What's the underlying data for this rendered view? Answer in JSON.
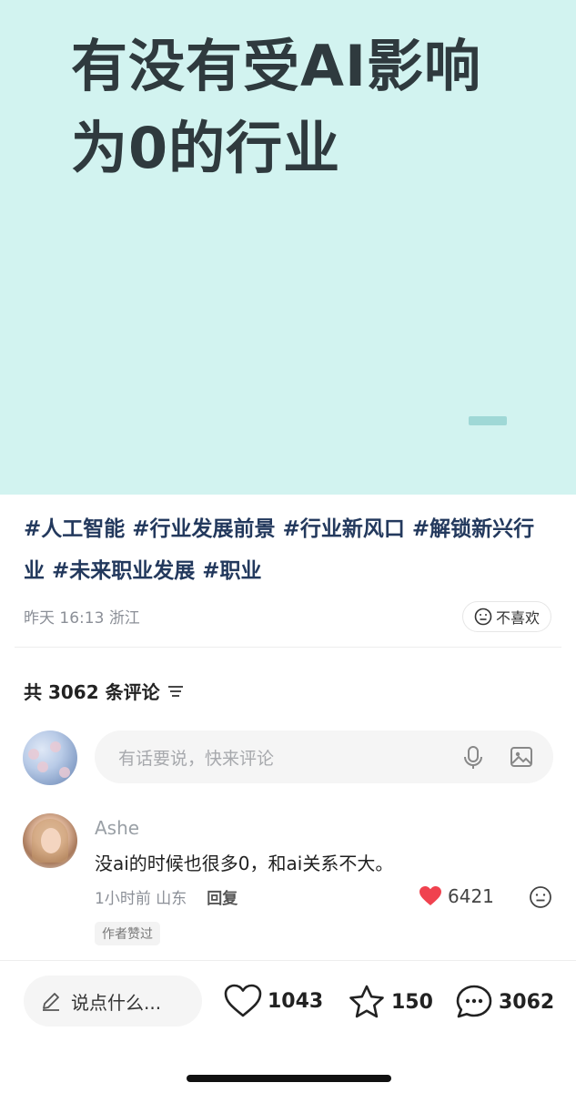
{
  "cover": {
    "title_line1": "有没有受AI影响",
    "title_line2": "为0的行业",
    "background": "#d2f3f0"
  },
  "tags": [
    "#人工智能",
    "#行业发展前景",
    "#行业新风口",
    "#解锁新兴行业",
    "#未来职业发展",
    "#职业"
  ],
  "meta": {
    "time": "昨天 16:13",
    "location": "浙江",
    "dislike_label": "不喜欢"
  },
  "comments": {
    "count_label": "共 3062 条评论",
    "input_placeholder": "有话要说，快来评论",
    "items": [
      {
        "author": "Ashe",
        "text": "没ai的时候也很多0，和ai关系不大。",
        "time": "1小时前",
        "location": "山东",
        "reply_label": "回复",
        "likes": "6421",
        "badge": "作者赞过"
      }
    ]
  },
  "bottom_bar": {
    "input_label": "说点什么...",
    "likes": "1043",
    "favorites": "150",
    "comments": "3062"
  },
  "colors": {
    "accent_heart": "#f0424f",
    "tag_text": "#23395d"
  },
  "icons": [
    "mic-icon",
    "image-icon",
    "filter-icon",
    "neutral-face-icon",
    "heart-icon",
    "star-icon",
    "comment-bubble-icon",
    "pencil-icon"
  ]
}
